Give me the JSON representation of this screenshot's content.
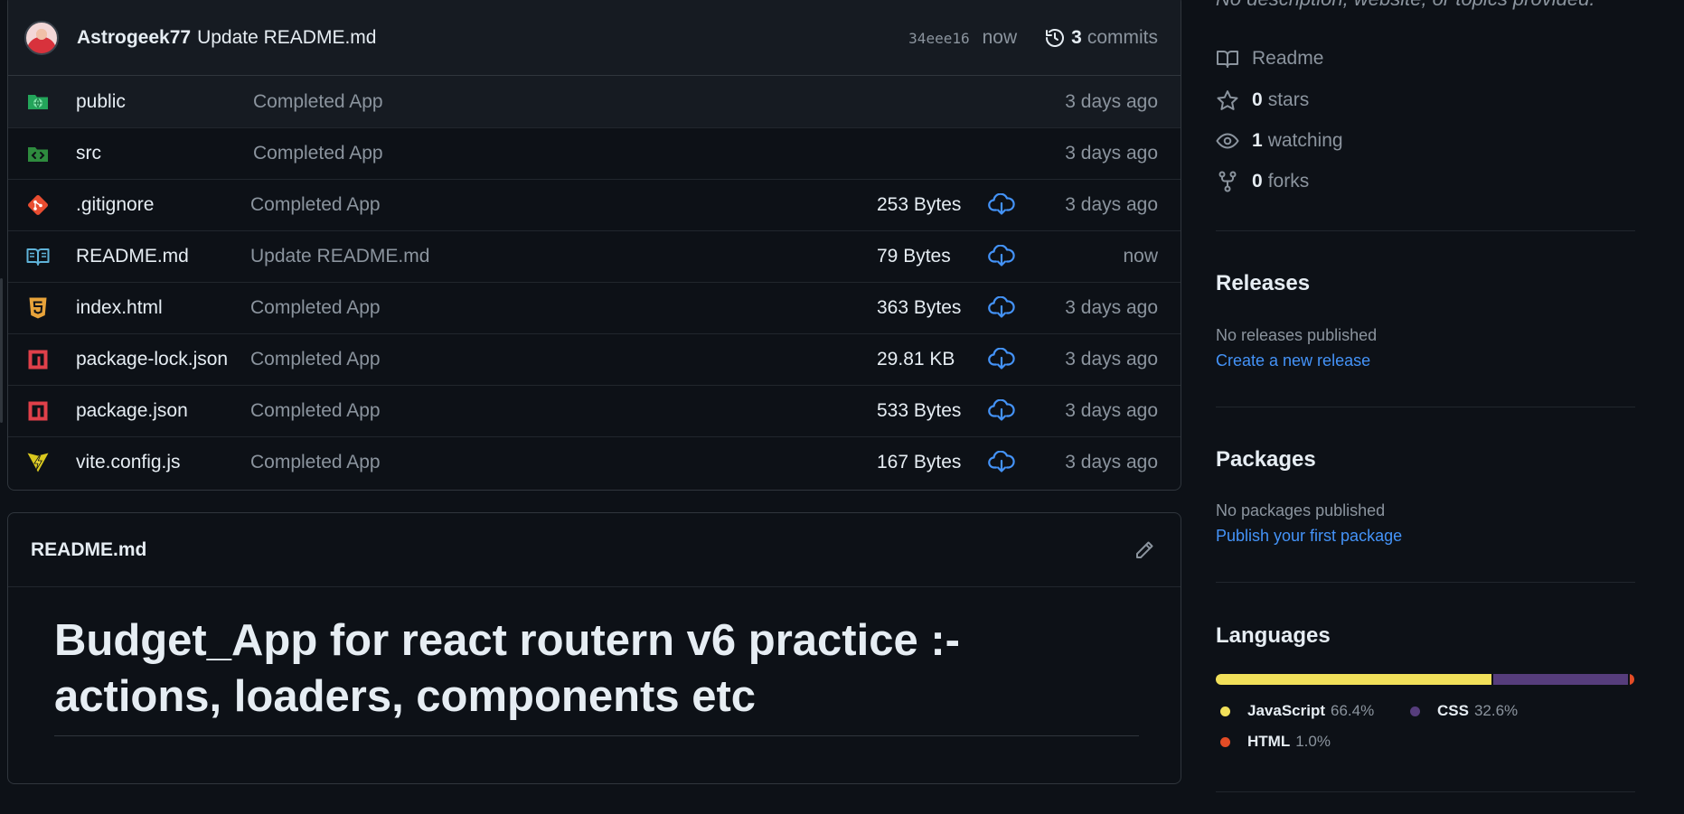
{
  "last_commit": {
    "author": "Astrogeek77",
    "message": "Update README.md",
    "sha": "34eee16",
    "time": "now",
    "commit_count": "3",
    "commit_label": "commits"
  },
  "files": [
    {
      "name": "public",
      "type": "folder",
      "message": "Completed App",
      "size": "",
      "age": "3 days ago",
      "icon": "folder-public-icon"
    },
    {
      "name": "src",
      "type": "folder",
      "message": "Completed App",
      "size": "",
      "age": "3 days ago",
      "icon": "folder-src-icon"
    },
    {
      "name": ".gitignore",
      "type": "file",
      "message": "Completed App",
      "size": "253 Bytes",
      "age": "3 days ago",
      "icon": "git-icon"
    },
    {
      "name": "README.md",
      "type": "file",
      "message": "Update README.md",
      "size": "79 Bytes",
      "age": "now",
      "icon": "book-icon"
    },
    {
      "name": "index.html",
      "type": "file",
      "message": "Completed App",
      "size": "363 Bytes",
      "age": "3 days ago",
      "icon": "html5-icon"
    },
    {
      "name": "package-lock.json",
      "type": "file",
      "message": "Completed App",
      "size": "29.81 KB",
      "age": "3 days ago",
      "icon": "npm-icon"
    },
    {
      "name": "package.json",
      "type": "file",
      "message": "Completed App",
      "size": "533 Bytes",
      "age": "3 days ago",
      "icon": "npm-icon"
    },
    {
      "name": "vite.config.js",
      "type": "file",
      "message": "Completed App",
      "size": "167 Bytes",
      "age": "3 days ago",
      "icon": "vite-icon"
    }
  ],
  "readme": {
    "file_label": "README.md",
    "heading": "Budget_App for react routern v6 practice :- actions, loaders, components etc"
  },
  "about": {
    "description": "No description, website, or topics provided.",
    "readme_label": "Readme",
    "stars_count": "0",
    "stars_label": "stars",
    "watching_count": "1",
    "watching_label": "watching",
    "forks_count": "0",
    "forks_label": "forks"
  },
  "releases": {
    "title": "Releases",
    "empty": "No releases published",
    "link": "Create a new release"
  },
  "packages": {
    "title": "Packages",
    "empty": "No packages published",
    "link": "Publish your first package"
  },
  "languages": {
    "title": "Languages",
    "items": [
      {
        "name": "JavaScript",
        "percent": "66.4%",
        "value": 66.4,
        "color": "#f1e05a"
      },
      {
        "name": "CSS",
        "percent": "32.6%",
        "value": 32.6,
        "color": "#563d7c"
      },
      {
        "name": "HTML",
        "percent": "1.0%",
        "value": 1.0,
        "color": "#e34c26"
      }
    ]
  },
  "colors": {
    "background": "#0d1117",
    "border": "#30363d",
    "muted": "#8b949e",
    "link": "#4493f8"
  }
}
